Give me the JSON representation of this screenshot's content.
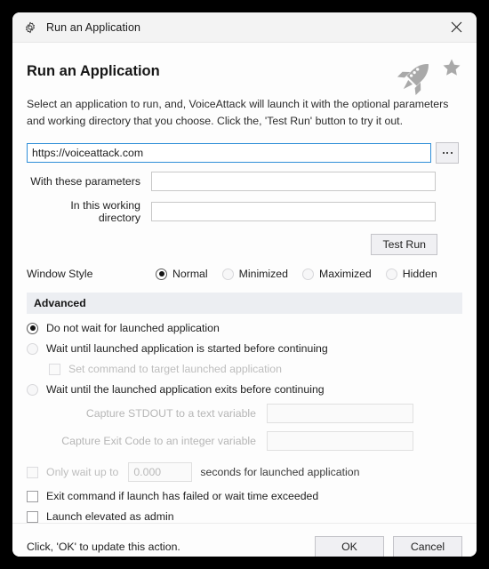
{
  "window": {
    "title": "Run an Application",
    "gear_icon": "gear-icon",
    "close_icon": "close-icon"
  },
  "header": {
    "title": "Run an Application",
    "rocket_icon": "rocket-icon",
    "star_icon": "star-icon"
  },
  "description": "Select an application to run, and, VoiceAttack will launch it with the optional parameters and working directory that you choose.  Click the, 'Test Run' button to try it out.",
  "path": {
    "value": "https://voiceattack.com",
    "browse_label": "...",
    "browse_icon": "ellipsis-icon"
  },
  "fields": [
    {
      "label": "With these parameters",
      "value": ""
    },
    {
      "label": "In this working directory",
      "value": ""
    }
  ],
  "test_run": {
    "label": "Test Run"
  },
  "window_style": {
    "label": "Window Style",
    "options": [
      {
        "label": "Normal",
        "selected": true
      },
      {
        "label": "Minimized",
        "selected": false
      },
      {
        "label": "Maximized",
        "selected": false
      },
      {
        "label": "Hidden",
        "selected": false
      }
    ]
  },
  "advanced": {
    "title": "Advanced",
    "wait_options": [
      {
        "label": "Do not wait for launched application",
        "selected": true
      },
      {
        "label": "Wait until launched application is started before continuing",
        "selected": false
      },
      {
        "label": "Wait until the launched application exits before continuing",
        "selected": false
      }
    ],
    "target_checkbox": {
      "label": "Set command to target launched application",
      "checked": false,
      "disabled": true
    },
    "captures": [
      {
        "label": "Capture STDOUT to a text variable",
        "value": ""
      },
      {
        "label": "Capture Exit Code to an integer variable",
        "value": ""
      }
    ],
    "only_wait": {
      "label": "Only wait up to",
      "value": "0.000",
      "suffix": "seconds for launched application",
      "checked": false
    },
    "exit_command": {
      "label": "Exit command if launch has failed or wait time exceeded",
      "checked": false
    },
    "launch_elevated": {
      "label": "Launch elevated as admin",
      "checked": false
    }
  },
  "footer": {
    "status": "Click, 'OK' to update this action.",
    "ok_label": "OK",
    "cancel_label": "Cancel"
  },
  "colors": {
    "focus_border": "#2f8fd8",
    "advanced_band": "#eceef2",
    "icon_gray": "#a9a9a9"
  }
}
